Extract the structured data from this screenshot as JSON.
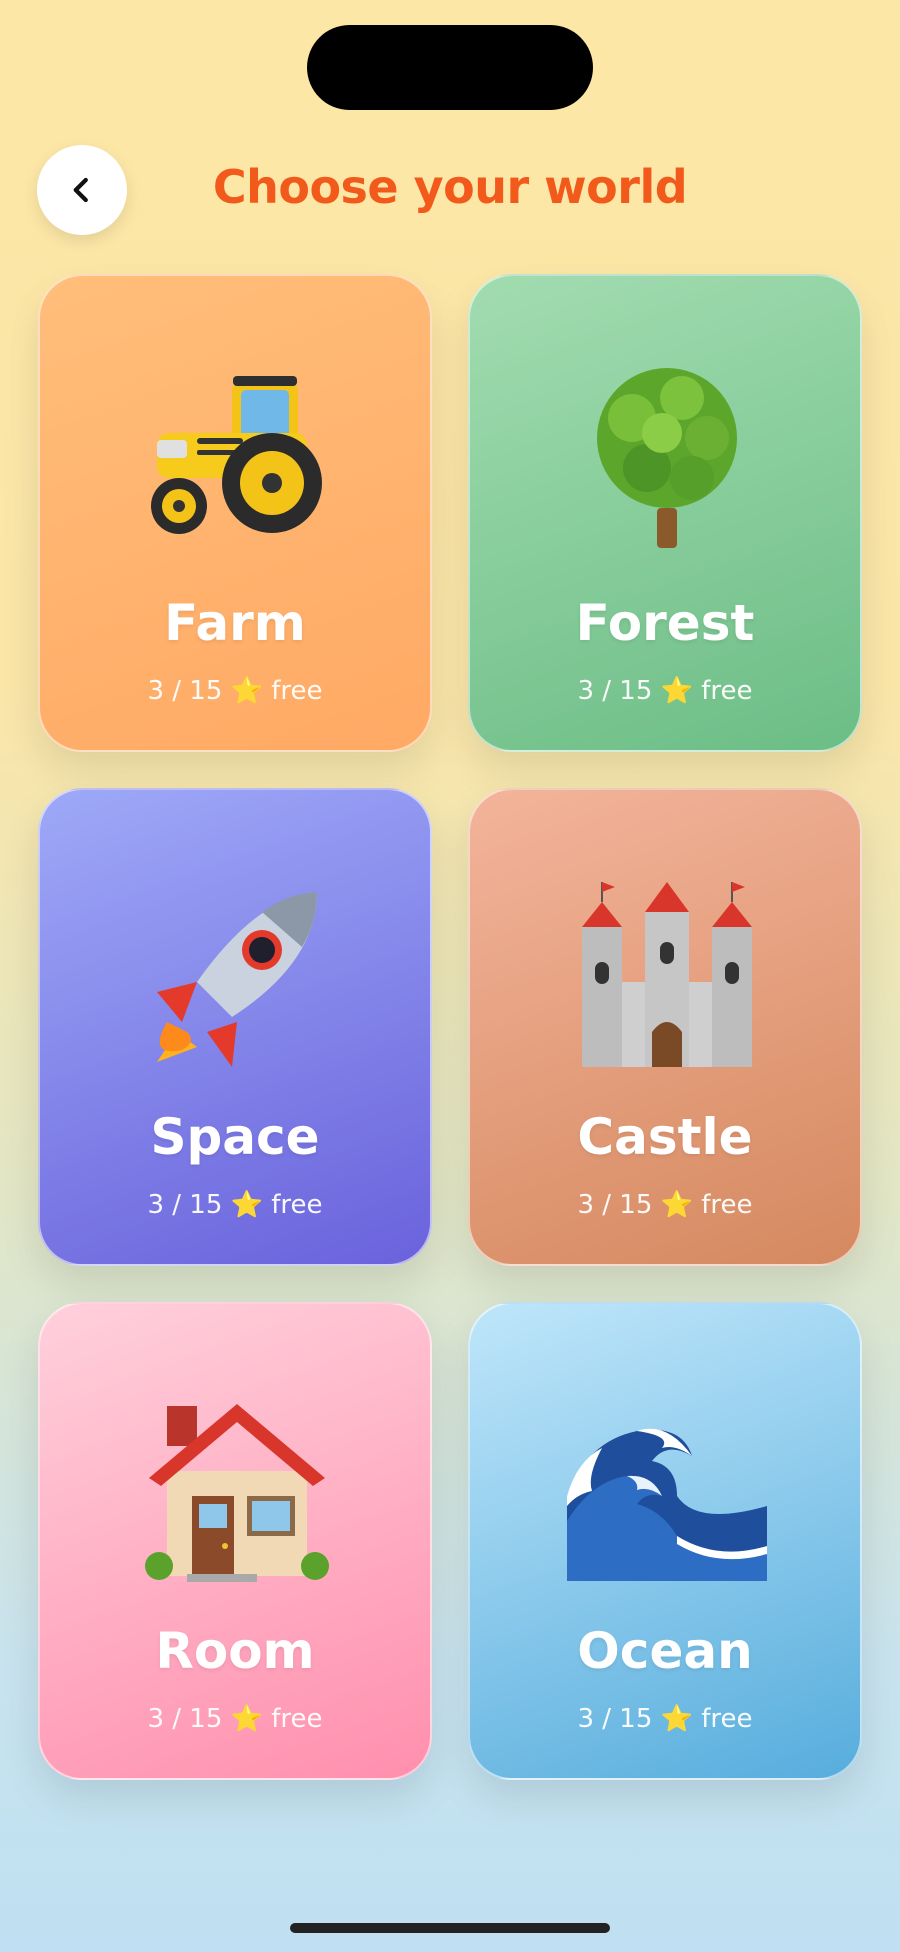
{
  "header": {
    "title": "Choose your world",
    "back_icon": "chevron-left-icon"
  },
  "worlds": [
    {
      "name": "Farm",
      "icon": "tractor-icon",
      "progress": "3 / 15",
      "star": "⭐",
      "suffix": "free",
      "color": "#ffb06c"
    },
    {
      "name": "Forest",
      "icon": "tree-icon",
      "progress": "3 / 15",
      "star": "⭐",
      "suffix": "free",
      "color": "#7cc793"
    },
    {
      "name": "Space",
      "icon": "rocket-icon",
      "progress": "3 / 15",
      "star": "⭐",
      "suffix": "free",
      "color": "#7a75e6"
    },
    {
      "name": "Castle",
      "icon": "castle-icon",
      "progress": "3 / 15",
      "star": "⭐",
      "suffix": "free",
      "color": "#e09a72"
    },
    {
      "name": "Room",
      "icon": "house-icon",
      "progress": "3 / 15",
      "star": "⭐",
      "suffix": "free",
      "color": "#ffa2bb"
    },
    {
      "name": "Ocean",
      "icon": "wave-icon",
      "progress": "3 / 15",
      "star": "⭐",
      "suffix": "free",
      "color": "#70b9e5"
    }
  ],
  "theme": {
    "title_color": "#f25a1c",
    "background_top": "#fde7a6",
    "background_bottom": "#bfe0f2"
  }
}
